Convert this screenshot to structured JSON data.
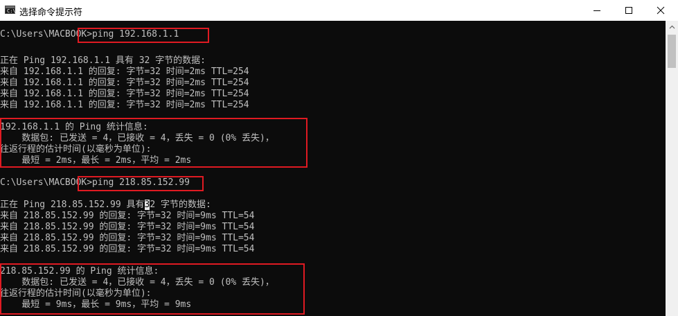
{
  "window": {
    "title": "选择命令提示符",
    "icon_label": "C:\\",
    "controls": [
      "minimize-icon",
      "maximize-icon",
      "close-icon"
    ]
  },
  "console": {
    "lines": [
      "C:\\Users\\MACBOOK>ping 192.168.1.1",
      "",
      "正在 Ping 192.168.1.1 具有 32 字节的数据:",
      "来自 192.168.1.1 的回复: 字节=32 时间=2ms TTL=254",
      "来自 192.168.1.1 的回复: 字节=32 时间=2ms TTL=254",
      "来自 192.168.1.1 的回复: 字节=32 时间=2ms TTL=254",
      "来自 192.168.1.1 的回复: 字节=32 时间=2ms TTL=254",
      "",
      "192.168.1.1 的 Ping 统计信息:",
      "    数据包: 已发送 = 4，已接收 = 4，丢失 = 0 (0% 丢失)，",
      "往返行程的估计时间(以毫秒为单位):",
      "    最短 = 2ms，最长 = 2ms，平均 = 2ms",
      "",
      "C:\\Users\\MACBOOK>ping 218.85.152.99",
      "",
      "正在 Ping 218.85.152.99 具有",
      "来自 218.85.152.99 的回复: 字节=32 时间=9ms TTL=54",
      "来自 218.85.152.99 的回复: 字节=32 时间=9ms TTL=54",
      "来自 218.85.152.99 的回复: 字节=32 时间=9ms TTL=54",
      "来自 218.85.152.99 的回复: 字节=32 时间=9ms TTL=54",
      "",
      "218.85.152.99 的 Ping 统计信息:",
      "    数据包: 已发送 = 4，已接收 = 4，丢失 = 0 (0% 丢失)，",
      "往返行程的估计时间(以毫秒为单位):",
      "    最短 = 9ms，最长 = 9ms，平均 = 9ms"
    ],
    "cursor_char": "3",
    "cursor_rest": "2 字节的数据:"
  },
  "colors": {
    "background": "#0c0c0c",
    "text": "#c0c0c0",
    "highlight": "#e01a22"
  }
}
